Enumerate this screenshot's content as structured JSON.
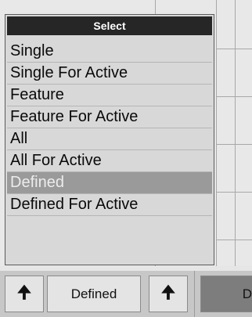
{
  "popup": {
    "title": "Select",
    "items": [
      {
        "label": "Single",
        "selected": false
      },
      {
        "label": "Single For Active",
        "selected": false
      },
      {
        "label": "Feature",
        "selected": false
      },
      {
        "label": "Feature For Active",
        "selected": false
      },
      {
        "label": "All",
        "selected": false
      },
      {
        "label": "All For Active",
        "selected": false
      },
      {
        "label": "Defined",
        "selected": true
      },
      {
        "label": "Defined For Active",
        "selected": false
      }
    ]
  },
  "toolbar": {
    "up_arrow_left": "🠉",
    "main_label": "Defined",
    "up_arrow_right": "🠉",
    "right_partial": "D"
  },
  "colors": {
    "title_bg": "#262626",
    "selected_bg": "#9a9a9a"
  }
}
